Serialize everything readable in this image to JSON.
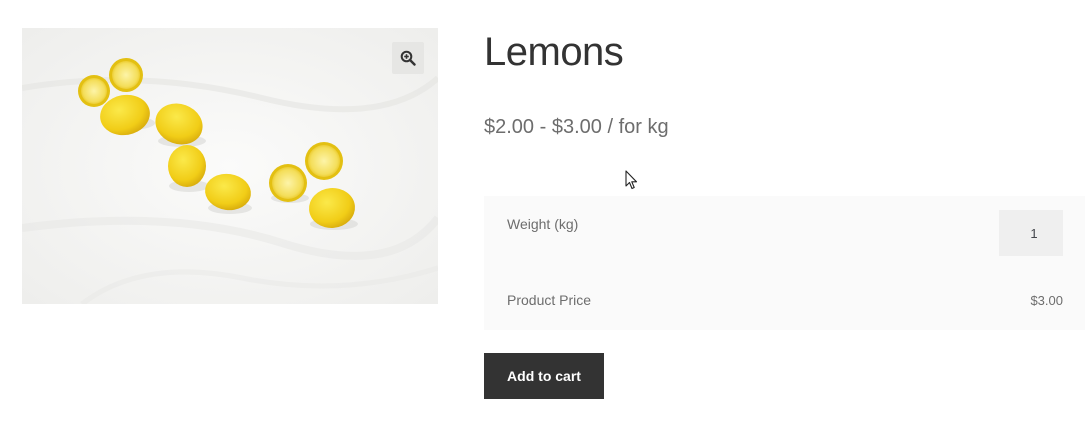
{
  "product": {
    "title": "Lemons",
    "price_low": "$2.00",
    "price_sep": "-",
    "price_high": "$3.00",
    "price_suffix": "/ for kg",
    "image_alt": "Lemons on a white cloth"
  },
  "options": {
    "weight_label": "Weight (kg)",
    "weight_value": "1",
    "product_price_label": "Product Price",
    "product_price_value": "$3.00"
  },
  "actions": {
    "add_to_cart_label": "Add to cart"
  },
  "icons": {
    "zoom": "zoom-in-icon",
    "cursor": "mouse-pointer-icon"
  },
  "colors": {
    "button_bg": "#333333",
    "lemon": "#f2d11c"
  }
}
